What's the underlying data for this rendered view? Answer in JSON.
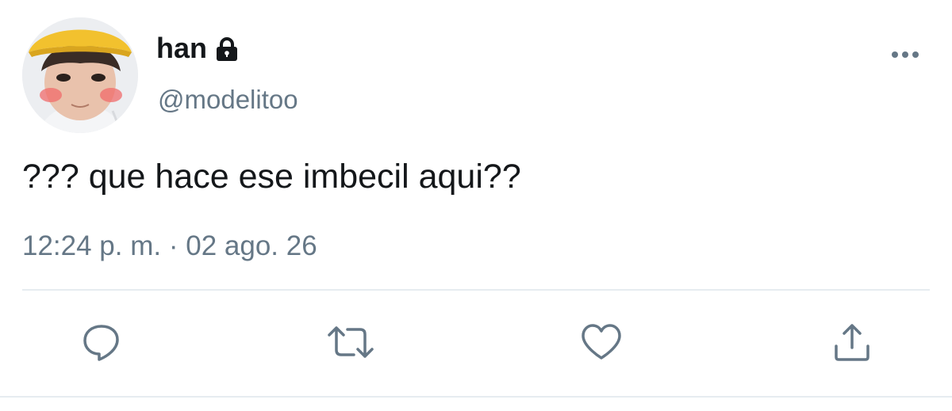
{
  "tweet": {
    "display_name": "han",
    "handle": "@modelitoo",
    "text": "??? que hace ese imbecil aqui??",
    "time": "12:24 p. m.",
    "separator": "·",
    "date": "02 ago. 26",
    "author_icons": [
      "lock-icon"
    ]
  },
  "actions": [
    {
      "icon": "reply-icon"
    },
    {
      "icon": "retweet-icon"
    },
    {
      "icon": "like-icon"
    },
    {
      "icon": "share-icon"
    }
  ],
  "menu": {
    "icon": "more-icon"
  },
  "colors": {
    "text_primary": "#14171a",
    "text_secondary": "#657786",
    "icon": "#657786",
    "divider": "#e6ecf0",
    "background": "#ffffff"
  }
}
